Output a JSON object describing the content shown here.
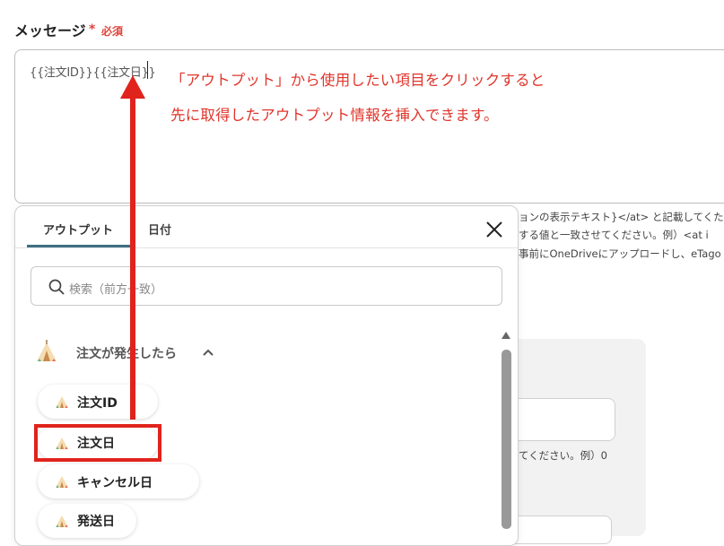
{
  "field": {
    "label": "メッセージ",
    "required_mark": "*",
    "required_text": "必須"
  },
  "message": {
    "value": "{{注文ID}}{{注文日}}"
  },
  "annotation": {
    "line1": "「アウトプット」から使用したい項目をクリックすると",
    "line2": "先に取得したアウトプット情報を挿入できます。",
    "color": "#e0352b"
  },
  "help": {
    "line1": "ョンの表示テキスト}</at> と記載してくた",
    "line2": "する値と一致させてください。例）<at i",
    "line3": "事前にOneDriveにアップロードし、eTago",
    "line4": "てください。例）0"
  },
  "popup": {
    "tabs": [
      {
        "label": "アウトプット",
        "active": true
      },
      {
        "label": "日付",
        "active": false
      }
    ],
    "close_icon": "close-icon",
    "search": {
      "placeholder": "検索（前方一致）",
      "icon": "search-icon"
    },
    "group": {
      "label": "注文が発生したら",
      "icon": "tent-icon",
      "expanded": true
    },
    "items": [
      {
        "label": "注文ID",
        "icon": "tent-icon"
      },
      {
        "label": "注文日",
        "icon": "tent-icon",
        "highlighted": true
      },
      {
        "label": "キャンセル日",
        "icon": "tent-icon"
      },
      {
        "label": "発送日",
        "icon": "tent-icon"
      }
    ]
  },
  "colors": {
    "accent_tab": "#3f6f82",
    "highlight": "#e0231c",
    "required": "#e0443c"
  }
}
